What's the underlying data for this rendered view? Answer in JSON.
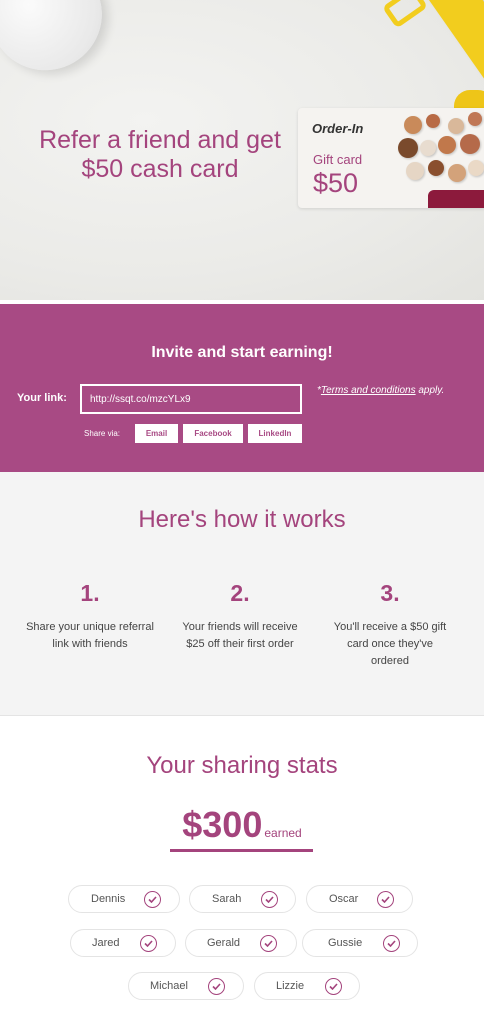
{
  "hero": {
    "title_line1": "Refer a friend and get",
    "title_line2": "$50 cash card",
    "card": {
      "brand": "Order-In",
      "label": "Gift card",
      "value": "$50"
    }
  },
  "invite": {
    "title": "Invite and start earning!",
    "link_label": "Your link:",
    "link_value": "http://ssqt.co/mzcYLx9",
    "terms_prefix": "*",
    "terms_link": "Terms and conditions",
    "terms_suffix": " apply.",
    "share_label": "Share via:",
    "share_buttons": [
      "Email",
      "Facebook",
      "LinkedIn"
    ]
  },
  "how": {
    "title": "Here's how it works",
    "steps": [
      {
        "num": "1.",
        "text": "Share your unique referral link with friends"
      },
      {
        "num": "2.",
        "text": "Your friends will receive $25 off their first order"
      },
      {
        "num": "3.",
        "text": "You'll receive a $50 gift card once they've ordered"
      }
    ]
  },
  "stats": {
    "title": "Your sharing stats",
    "amount": "$300",
    "amount_label": "earned",
    "friends": [
      "Dennis",
      "Sarah",
      "Oscar",
      "Jared",
      "Gerald",
      "Gussie",
      "Michael",
      "Lizzie"
    ]
  },
  "colors": {
    "accent": "#a4447d",
    "band": "#a84a84",
    "yellow": "#f2cd1e"
  }
}
